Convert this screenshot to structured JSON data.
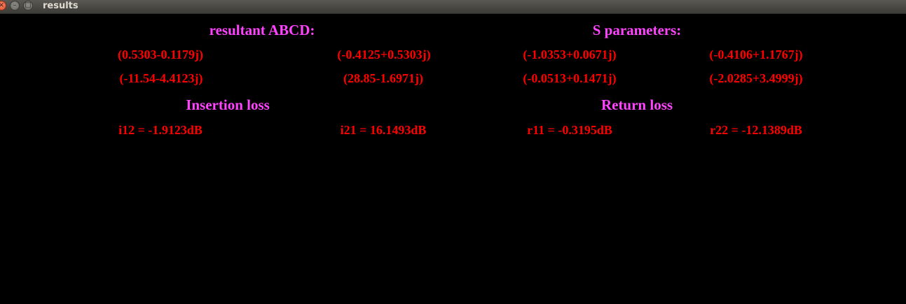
{
  "window": {
    "title": "results",
    "close_glyph": "×",
    "min_glyph": "–",
    "max_glyph": "□"
  },
  "abcd": {
    "heading": "resultant ABCD:",
    "a": "(0.5303-0.1179j)",
    "b": "(-0.4125+0.5303j)",
    "c": "(-11.54-4.4123j)",
    "d": "(28.85-1.6971j)"
  },
  "s_params": {
    "heading": "S parameters:",
    "s11": "(-1.0353+0.0671j)",
    "s12": "(-0.4106+1.1767j)",
    "s21": "(-0.0513+0.1471j)",
    "s22": "(-2.0285+3.4999j)"
  },
  "insertion_loss": {
    "heading": "Insertion loss",
    "i12": "i12 = -1.9123dB",
    "i21": "i21 = 16.1493dB"
  },
  "return_loss": {
    "heading": "Return loss",
    "r11": "r11 = -0.3195dB",
    "r22": "r22 = -12.1389dB"
  },
  "colors": {
    "heading": "#ff44ff",
    "value": "#ff0000",
    "background": "#000000"
  }
}
